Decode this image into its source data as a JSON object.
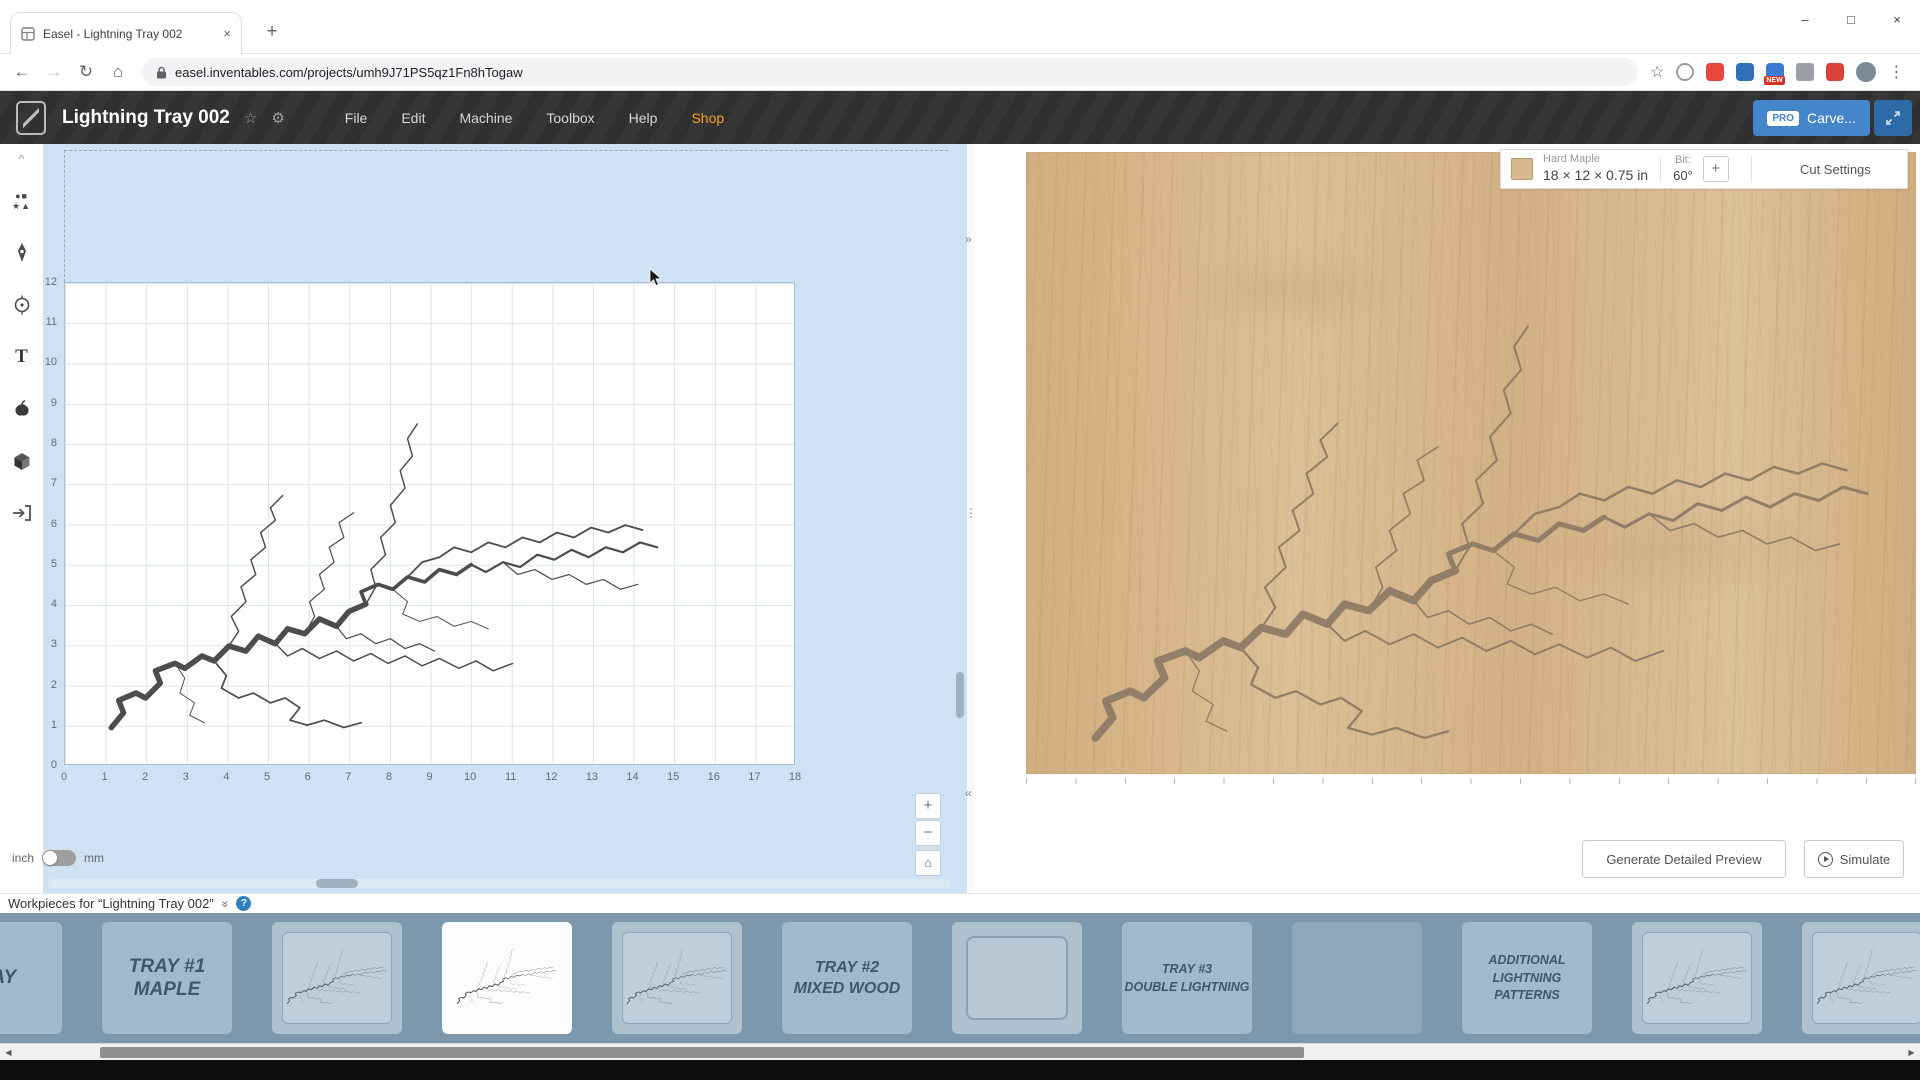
{
  "colors": {
    "accent_blue": "#4486c9",
    "shop_orange": "#f6a21e",
    "canvas_blue": "#cfe2f4",
    "wood_tan": "#d8b88e",
    "strip_blue": "#7d98ad",
    "help_blue": "#2f80c3"
  },
  "browser": {
    "tab_title": "Easel - Lightning Tray 002",
    "url": "easel.inventables.com/projects/umh9J71PS5qz1Fn8hTogaw",
    "new_badge": "NEW"
  },
  "icons": {
    "new_tab": "+",
    "tab_close": "×",
    "minimize": "–",
    "maximize": "□",
    "close": "×",
    "back": "←",
    "forward": "→",
    "reload": "↻",
    "home": "⌂",
    "bookmark": "☆",
    "kebab": "⋮",
    "star": "☆",
    "gear": "⚙",
    "toolbar_collapse": "^",
    "shapes_row1": "●■",
    "shapes_row2": "★▲",
    "text_tool": "T",
    "panel_right": "»",
    "drag_dots": "⋮",
    "panel_left": "«",
    "zoom_in": "+",
    "zoom_out": "−",
    "home_view": "⌂",
    "workpieces_collapse": "»",
    "help": "?",
    "scroll_left": "◀",
    "scroll_right": "▶"
  },
  "header": {
    "title": "Lightning Tray 002",
    "menus": [
      "File",
      "Edit",
      "Machine",
      "Toolbox",
      "Help",
      "Shop"
    ],
    "carve": {
      "pro": "PRO",
      "label": "Carve..."
    }
  },
  "canvas": {
    "ruler_x": [
      "0",
      "1",
      "2",
      "3",
      "4",
      "5",
      "6",
      "7",
      "8",
      "9",
      "10",
      "11",
      "12",
      "13",
      "14",
      "15",
      "16",
      "17",
      "18"
    ],
    "ruler_y": [
      "12",
      "11",
      "10",
      "9",
      "8",
      "7",
      "6",
      "5",
      "4",
      "3",
      "2",
      "1",
      "0"
    ],
    "units": {
      "inch": "inch",
      "mm": "mm"
    }
  },
  "preview": {
    "material": {
      "name": "Hard Maple",
      "dimensions": "18 × 12 × 0.75 in",
      "bit_label": "Bit:",
      "bit_value": "60°",
      "add": "+",
      "cut_settings": "Cut Settings"
    },
    "buttons": {
      "generate": "Generate Detailed Preview",
      "simulate": "Simulate"
    }
  },
  "workpieces": {
    "heading": "Workpieces for “Lightning Tray 002”",
    "items": [
      {
        "type": "label",
        "lines": [
          "RAY"
        ],
        "size": "lg",
        "clip": -68
      },
      {
        "type": "label",
        "lines": [
          "TRAY #1",
          "MAPLE"
        ],
        "size": "lg"
      },
      {
        "type": "thumb"
      },
      {
        "type": "thumb",
        "selected": true
      },
      {
        "type": "thumb"
      },
      {
        "type": "label",
        "lines": [
          "TRAY #2",
          "MIXED WOOD"
        ],
        "size": "md"
      },
      {
        "type": "empty"
      },
      {
        "type": "label",
        "lines": [
          "TRAY #3",
          "DOUBLE LIGHTNING"
        ],
        "size": "sm"
      },
      {
        "type": "blank"
      },
      {
        "type": "label",
        "lines": [
          "ADDITIONAL",
          "LIGHTNING",
          "PATTERNS"
        ],
        "size": "sm"
      },
      {
        "type": "thumb"
      },
      {
        "type": "thumb"
      }
    ]
  }
}
